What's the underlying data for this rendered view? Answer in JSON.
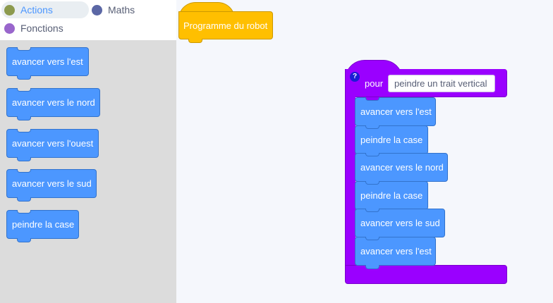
{
  "categories": [
    {
      "label": "Actions",
      "color": "#8c9a4e",
      "active": true
    },
    {
      "label": "Maths",
      "color": "#5b67a5",
      "active": false
    },
    {
      "label": "Fonctions",
      "color": "#9966cc",
      "active": false
    }
  ],
  "palette": {
    "blocks": [
      "avancer vers l'est",
      "avancer vers le nord",
      "avancer vers l'ouest",
      "avancer vers le sud",
      "peindre la case"
    ]
  },
  "workspace": {
    "hat_label": "Programme du robot",
    "procedure": {
      "help_glyph": "?",
      "keyword": "pour",
      "name": "peindre un trait vertical",
      "blocks": [
        "avancer vers l'est",
        "peindre la case",
        "avancer vers le nord",
        "peindre la case",
        "avancer vers le sud",
        "avancer vers l'est"
      ]
    }
  },
  "colors": {
    "motion_block": "#4c97ff",
    "hat_block": "#ffbf00",
    "procedure_block": "#9a00ff"
  }
}
